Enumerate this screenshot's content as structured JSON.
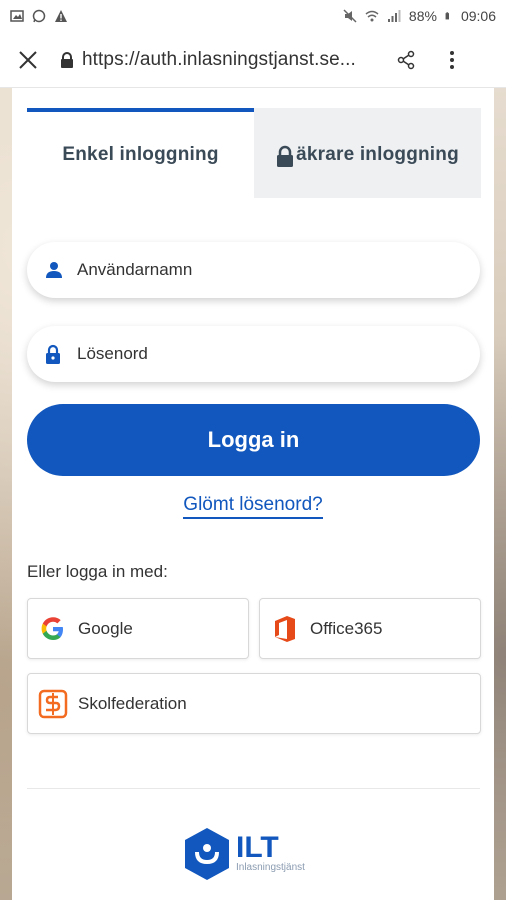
{
  "status_bar": {
    "battery_percent": "88%",
    "time": "09:06"
  },
  "browser": {
    "url": "https://auth.inlasningstjanst.se..."
  },
  "tabs": [
    {
      "label": "Enkel inloggning",
      "active": true
    },
    {
      "label": "äkrare inloggning",
      "active": false
    }
  ],
  "form": {
    "username_placeholder": "Användarnamn",
    "password_placeholder": "Lösenord",
    "login_label": "Logga in",
    "forgot_label": "Glömt lösenord?"
  },
  "alternatives": {
    "heading": "Eller logga in med:",
    "google_label": "Google",
    "office_label": "Office365",
    "skolfed_label": "Skolfederation"
  },
  "logo": {
    "title": "ILT",
    "subtitle": "Inlasningstjänst"
  },
  "colors": {
    "accent": "#1157bd",
    "office": "#e64a19",
    "skolfed": "#f26b21"
  }
}
